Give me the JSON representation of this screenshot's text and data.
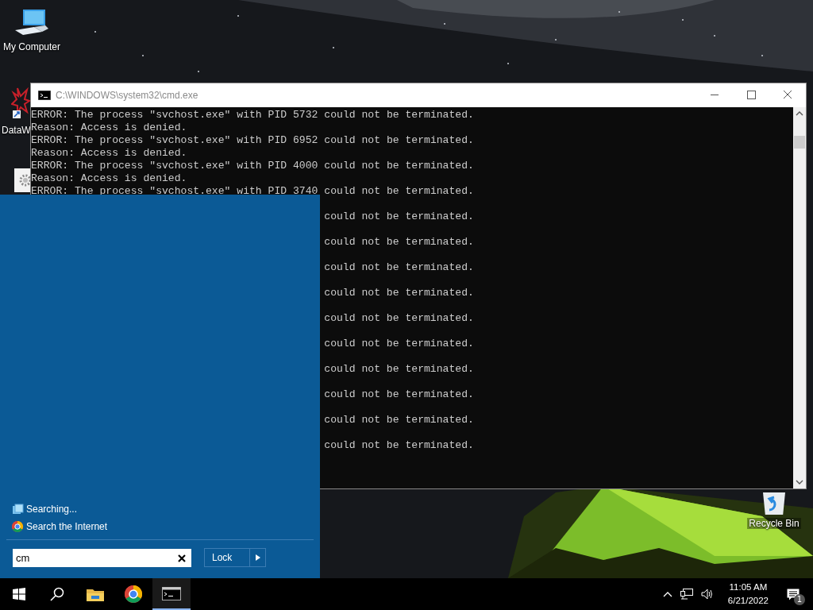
{
  "desktop": {
    "icons": [
      {
        "kind": "computer",
        "label": "My Computer"
      },
      {
        "kind": "app",
        "label": "DataW"
      },
      {
        "kind": "settings"
      }
    ],
    "recycle_bin": {
      "label": "Recycle Bin"
    }
  },
  "console_window": {
    "title": "C:\\WINDOWS\\system32\\cmd.exe",
    "lines": [
      {
        "kind": "full",
        "text": "ERROR: The process \"svchost.exe\" with PID 5732 could not be terminated."
      },
      {
        "kind": "full",
        "text": "Reason: Access is denied."
      },
      {
        "kind": "full",
        "text": "ERROR: The process \"svchost.exe\" with PID 6952 could not be terminated."
      },
      {
        "kind": "full",
        "text": "Reason: Access is denied."
      },
      {
        "kind": "full",
        "text": "ERROR: The process \"svchost.exe\" with PID 4000 could not be terminated."
      },
      {
        "kind": "full",
        "text": "Reason: Access is denied."
      },
      {
        "kind": "full",
        "text": "ERROR: The process \"svchost.exe\" with PID 3740 could not be terminated."
      },
      {
        "kind": "fragment",
        "text": "could not be terminated."
      },
      {
        "kind": "fragment",
        "text": "could not be terminated."
      },
      {
        "kind": "fragment",
        "text": "could not be terminated."
      },
      {
        "kind": "fragment",
        "text": "could not be terminated."
      },
      {
        "kind": "fragment",
        "text": "could not be terminated."
      },
      {
        "kind": "fragment",
        "text": "could not be terminated."
      },
      {
        "kind": "fragment",
        "text": "could not be terminated."
      },
      {
        "kind": "fragment",
        "text": "could not be terminated."
      },
      {
        "kind": "fragment",
        "text": "could not be terminated."
      },
      {
        "kind": "fragment",
        "text": "could not be terminated."
      }
    ]
  },
  "start_menu": {
    "results": [
      {
        "kind": "searching",
        "label": "Searching..."
      },
      {
        "kind": "web",
        "label": "Search the Internet"
      }
    ],
    "search": {
      "value": "cm"
    },
    "lock_button": {
      "label": "Lock"
    }
  },
  "taskbar": {
    "apps": [
      {
        "kind": "explorer",
        "selected": false
      },
      {
        "kind": "chrome",
        "selected": false
      },
      {
        "kind": "console",
        "selected": true
      }
    ],
    "clock": {
      "time": "11:05 AM",
      "date": "6/21/2022"
    },
    "notifications": {
      "badge": "1"
    }
  }
}
